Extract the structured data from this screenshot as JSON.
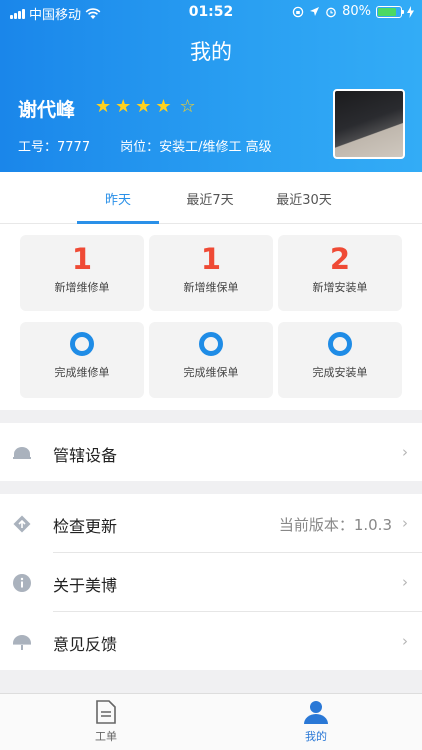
{
  "status_bar": {
    "carrier": "中国移动",
    "time": "01:52",
    "battery": "80%"
  },
  "header": {
    "title": "我的",
    "user_name": "谢代峰",
    "rating_stars": 4,
    "rating_max": 5,
    "stars_filled": "★★★★",
    "stars_empty": "☆",
    "employee_id": "工号：7777",
    "position": "岗位：安装工/维修工 高级"
  },
  "tabs": [
    {
      "label": "昨天",
      "active": true
    },
    {
      "label": "最近7天",
      "active": false
    },
    {
      "label": "最近30天",
      "active": false
    }
  ],
  "stats": [
    {
      "value": "1",
      "label": "新增维修单"
    },
    {
      "value": "1",
      "label": "新增维保单"
    },
    {
      "value": "2",
      "label": "新增安装单"
    },
    {
      "value": "0",
      "label": "完成维修单"
    },
    {
      "value": "0",
      "label": "完成维保单"
    },
    {
      "value": "0",
      "label": "完成安装单"
    }
  ],
  "menu": {
    "devices": {
      "label": "管辖设备",
      "icon": "helmet-icon"
    },
    "update": {
      "label": "检查更新",
      "value": "当前版本：1.0.3",
      "icon": "update-icon"
    },
    "about": {
      "label": "关于美博",
      "icon": "info-icon"
    },
    "feedback": {
      "label": "意见反馈",
      "icon": "feedback-icon"
    }
  },
  "tabbar": [
    {
      "label": "工单",
      "icon": "document-icon",
      "active": false
    },
    {
      "label": "我的",
      "icon": "person-icon",
      "active": true
    }
  ],
  "colors": {
    "primary": "#2a90e8",
    "header_gradient_start": "#1a86ea",
    "stat_number": "#ef4a35",
    "star": "#ffd21f"
  }
}
